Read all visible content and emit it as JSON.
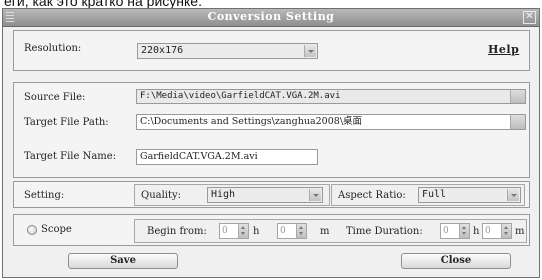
{
  "caption": "еги, как это кратко на рисунке.",
  "window": {
    "title": "Conversion Setting",
    "close_glyph": "✕"
  },
  "resolution": {
    "label": "Resolution:",
    "value": "220x176"
  },
  "help": {
    "label": "Help"
  },
  "files": {
    "source_label": "Source File:",
    "source_value": "F:\\Media\\video\\GarfieldCAT.VGA.2M.avi",
    "target_path_label": "Target File Path:",
    "target_path_value": "C:\\Documents and Settings\\zanghua2008\\桌面",
    "target_name_label": "Target File Name:",
    "target_name_value": "GarfieldCAT.VGA.2M.avi"
  },
  "setting": {
    "label": "Setting:",
    "quality_label": "Quality:",
    "quality_value": "High",
    "aspect_label": "Aspect Ratio:",
    "aspect_value": "Full"
  },
  "scope": {
    "label": "Scope",
    "begin_label": "Begin from:",
    "duration_label": "Time Duration:",
    "h_unit": "h",
    "m_unit": "m",
    "zero": "0"
  },
  "buttons": {
    "save": "Save",
    "close": "Close"
  },
  "colors": {
    "titlebar": "#9e9e9e",
    "panel": "#f4f4f4",
    "window": "#f0f0f0"
  }
}
